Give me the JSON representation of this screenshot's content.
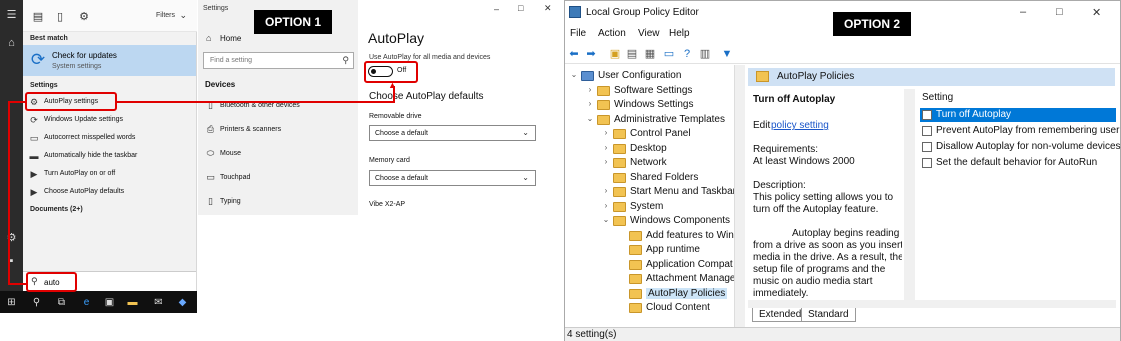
{
  "start_menu": {
    "tabs": {
      "filters": "Filters"
    },
    "best_match_header": "Best match",
    "best_match": {
      "title": "Check for updates",
      "subtitle": "System settings"
    },
    "settings_header": "Settings",
    "items": [
      {
        "label": "AutoPlay settings"
      },
      {
        "label": "Windows Update settings"
      },
      {
        "label": "Autocorrect misspelled words"
      },
      {
        "label": "Automatically hide the taskbar"
      },
      {
        "label": "Turn AutoPlay on or off"
      },
      {
        "label": "Choose AutoPlay defaults"
      }
    ],
    "documents_header": "Documents (2+)",
    "search_value": "auto"
  },
  "settings": {
    "window_title": "Settings",
    "option_label": "OPTION 1",
    "home": "Home",
    "find_placeholder": "Find a setting",
    "section": "Devices",
    "nav": [
      "Bluetooth & other devices",
      "Printers & scanners",
      "Mouse",
      "Touchpad",
      "Typing"
    ],
    "page_title": "AutoPlay",
    "use_label": "Use AutoPlay for all media and devices",
    "toggle_state": "Off",
    "choose_heading": "Choose AutoPlay defaults",
    "removable_label": "Removable drive",
    "removable_value": "Choose a default",
    "memory_label": "Memory card",
    "memory_value": "Choose a default",
    "device_label": "Vibe X2-AP"
  },
  "gpedit": {
    "window_title": "Local Group Policy Editor",
    "option_label": "OPTION 2",
    "menu": [
      "File",
      "Action",
      "View",
      "Help"
    ],
    "tree": [
      {
        "label": "User Configuration",
        "expander": "v",
        "level": 0
      },
      {
        "label": "Software Settings",
        "expander": ">",
        "level": 1
      },
      {
        "label": "Windows Settings",
        "expander": ">",
        "level": 1
      },
      {
        "label": "Administrative Templates",
        "expander": "v",
        "level": 1
      },
      {
        "label": "Control Panel",
        "expander": ">",
        "level": 2
      },
      {
        "label": "Desktop",
        "expander": ">",
        "level": 2
      },
      {
        "label": "Network",
        "expander": ">",
        "level": 2
      },
      {
        "label": "Shared Folders",
        "expander": "",
        "level": 2
      },
      {
        "label": "Start Menu and Taskbar",
        "expander": ">",
        "level": 2
      },
      {
        "label": "System",
        "expander": ">",
        "level": 2
      },
      {
        "label": "Windows Components",
        "expander": "v",
        "level": 2
      },
      {
        "label": "Add features to Win",
        "expander": "",
        "level": 3
      },
      {
        "label": "App runtime",
        "expander": "",
        "level": 3
      },
      {
        "label": "Application Compat",
        "expander": "",
        "level": 3
      },
      {
        "label": "Attachment Manage",
        "expander": "",
        "level": 3
      },
      {
        "label": "AutoPlay Policies",
        "expander": "",
        "level": 3,
        "selected": true
      },
      {
        "label": "Cloud Content",
        "expander": "",
        "level": 3
      }
    ],
    "panel_title": "AutoPlay Policies",
    "desc": {
      "title": "Turn off Autoplay",
      "edit_prefix": "Edit",
      "edit_link": "policy setting",
      "req_label": "Requirements:",
      "req_value": "At least Windows 2000",
      "desc_label": "Description:",
      "desc_lines": [
        "This policy setting allows you to",
        "turn off the Autoplay feature."
      ],
      "body_lines": [
        "        Autoplay begins reading",
        "from a drive as soon as you insert",
        "media in the drive. As a result, the",
        "setup file of programs and the",
        "music on audio media start",
        "immediately."
      ]
    },
    "column_header": "Setting",
    "settings": [
      {
        "label": "Turn off Autoplay",
        "selected": true
      },
      {
        "label": "Prevent AutoPlay from remembering user"
      },
      {
        "label": "Disallow Autoplay for non-volume devices"
      },
      {
        "label": "Set the default behavior for AutoRun"
      }
    ],
    "tabs": [
      "Extended",
      "Standard"
    ],
    "status": "4 setting(s)"
  }
}
